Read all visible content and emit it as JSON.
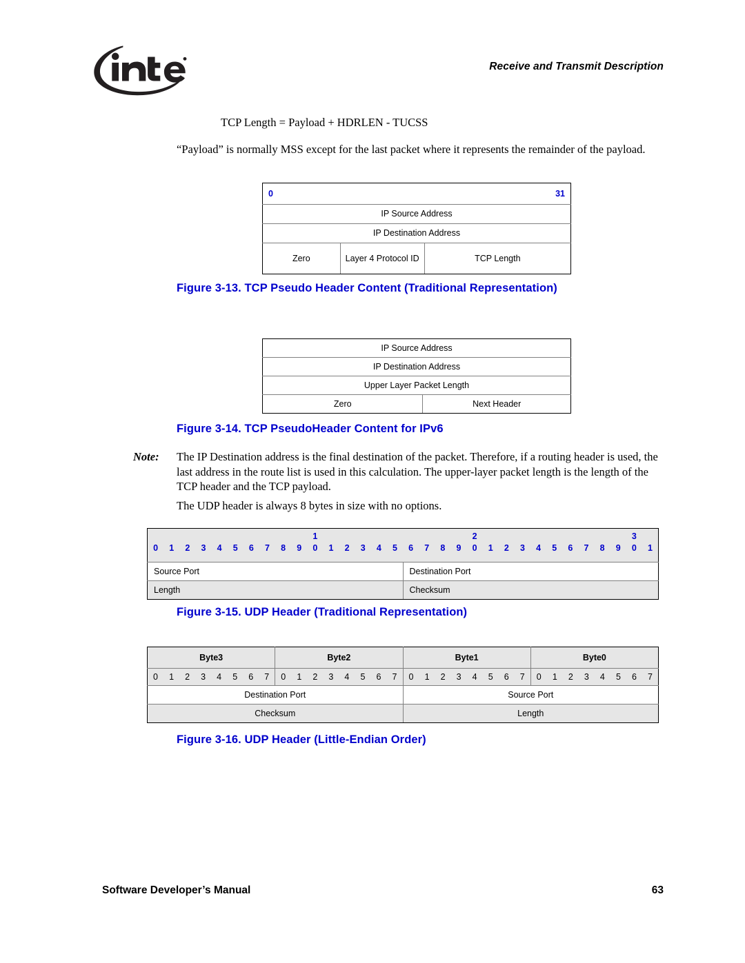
{
  "header": {
    "logo_name": "intel",
    "title": "Receive and Transmit Description"
  },
  "body": {
    "formula": "TCP Length = Payload + HDRLEN - TUCSS",
    "payload_paragraph": "“Payload” is normally MSS except for the last packet where it represents the remainder of the payload.",
    "note_label": "Note:",
    "note_text": "The IP Destination address is the final destination of the packet. Therefore, if a routing header is used, the last address in the route list is used in this calculation. The upper-layer packet length is the length of the TCP header and the TCP payload.",
    "udp_paragraph": "The UDP header is always 8 bytes in size with no options."
  },
  "figures": {
    "fig_3_13": {
      "caption": "Figure 3-13. TCP Pseudo Header Content (Traditional Representation)",
      "bit_start": "0",
      "bit_end": "31",
      "rows": [
        {
          "cells": [
            "IP Source Address"
          ]
        },
        {
          "cells": [
            "IP Destination Address"
          ]
        },
        {
          "cells": [
            "Zero",
            "Layer 4 Protocol ID",
            "TCP Length"
          ]
        }
      ]
    },
    "fig_3_14": {
      "caption": "Figure 3-14. TCP PseudoHeader Content for IPv6",
      "rows": [
        {
          "cells": [
            "IP Source Address"
          ]
        },
        {
          "cells": [
            "IP Destination Address"
          ]
        },
        {
          "cells": [
            "Upper Layer Packet Length"
          ]
        },
        {
          "cells": [
            "Zero",
            "Next Header"
          ]
        }
      ]
    },
    "fig_3_15": {
      "caption": "Figure 3-15. UDP Header (Traditional Representation)",
      "bit_tens": [
        "",
        "",
        "",
        "",
        "",
        "",
        "",
        "",
        "",
        "",
        "1",
        "",
        "",
        "",
        "",
        "",
        "",
        "",
        "",
        "",
        "2",
        "",
        "",
        "",
        "",
        "",
        "",
        "",
        "",
        "",
        "3",
        ""
      ],
      "bit_ones": [
        "0",
        "1",
        "2",
        "3",
        "4",
        "5",
        "6",
        "7",
        "8",
        "9",
        "0",
        "1",
        "2",
        "3",
        "4",
        "5",
        "6",
        "7",
        "8",
        "9",
        "0",
        "1",
        "2",
        "3",
        "4",
        "5",
        "6",
        "7",
        "8",
        "9",
        "0",
        "1"
      ],
      "rows": [
        {
          "cells": [
            "Source Port",
            "Destination Port"
          ],
          "shaded": false
        },
        {
          "cells": [
            "Length",
            "Checksum"
          ],
          "shaded": true
        }
      ]
    },
    "fig_3_16": {
      "caption": "Figure 3-16. UDP Header (Little-Endian Order)",
      "byte_headers": [
        "Byte3",
        "Byte2",
        "Byte1",
        "Byte0"
      ],
      "bit_ones": [
        "0",
        "1",
        "2",
        "3",
        "4",
        "5",
        "6",
        "7"
      ],
      "rows": [
        {
          "cells": [
            "Destination Port",
            "Source Port"
          ],
          "shaded": false
        },
        {
          "cells": [
            "Checksum",
            "Length"
          ],
          "shaded": true
        }
      ]
    }
  },
  "footer": {
    "left": "Software Developer’s Manual",
    "page_number": "63"
  },
  "colors": {
    "caption_blue": "#0000CC",
    "shade_gray": "#E6E6E6",
    "border_gray": "#808080",
    "text_black": "#000000"
  }
}
